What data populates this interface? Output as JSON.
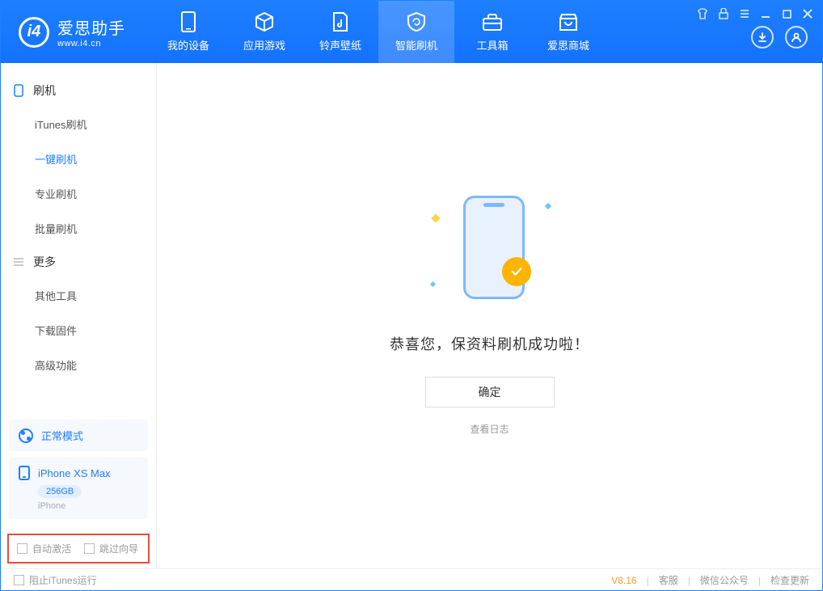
{
  "app": {
    "name": "爱思助手",
    "url": "www.i4.cn"
  },
  "nav": {
    "tabs": [
      {
        "label": "我的设备"
      },
      {
        "label": "应用游戏"
      },
      {
        "label": "铃声壁纸"
      },
      {
        "label": "智能刷机"
      },
      {
        "label": "工具箱"
      },
      {
        "label": "爱思商城"
      }
    ]
  },
  "sidebar": {
    "group1": {
      "title": "刷机",
      "items": [
        {
          "label": "iTunes刷机"
        },
        {
          "label": "一键刷机"
        },
        {
          "label": "专业刷机"
        },
        {
          "label": "批量刷机"
        }
      ]
    },
    "group2": {
      "title": "更多",
      "items": [
        {
          "label": "其他工具"
        },
        {
          "label": "下载固件"
        },
        {
          "label": "高级功能"
        }
      ]
    },
    "mode": "正常模式",
    "device": {
      "name": "iPhone XS Max",
      "storage": "256GB",
      "type": "iPhone"
    },
    "checks": {
      "auto_activate": "自动激活",
      "skip_guide": "跳过向导"
    }
  },
  "main": {
    "success_text": "恭喜您，保资料刷机成功啦！",
    "ok_button": "确定",
    "view_log": "查看日志"
  },
  "footer": {
    "block_itunes": "阻止iTunes运行",
    "version": "V8.16",
    "support": "客服",
    "wechat": "微信公众号",
    "update": "检查更新"
  }
}
